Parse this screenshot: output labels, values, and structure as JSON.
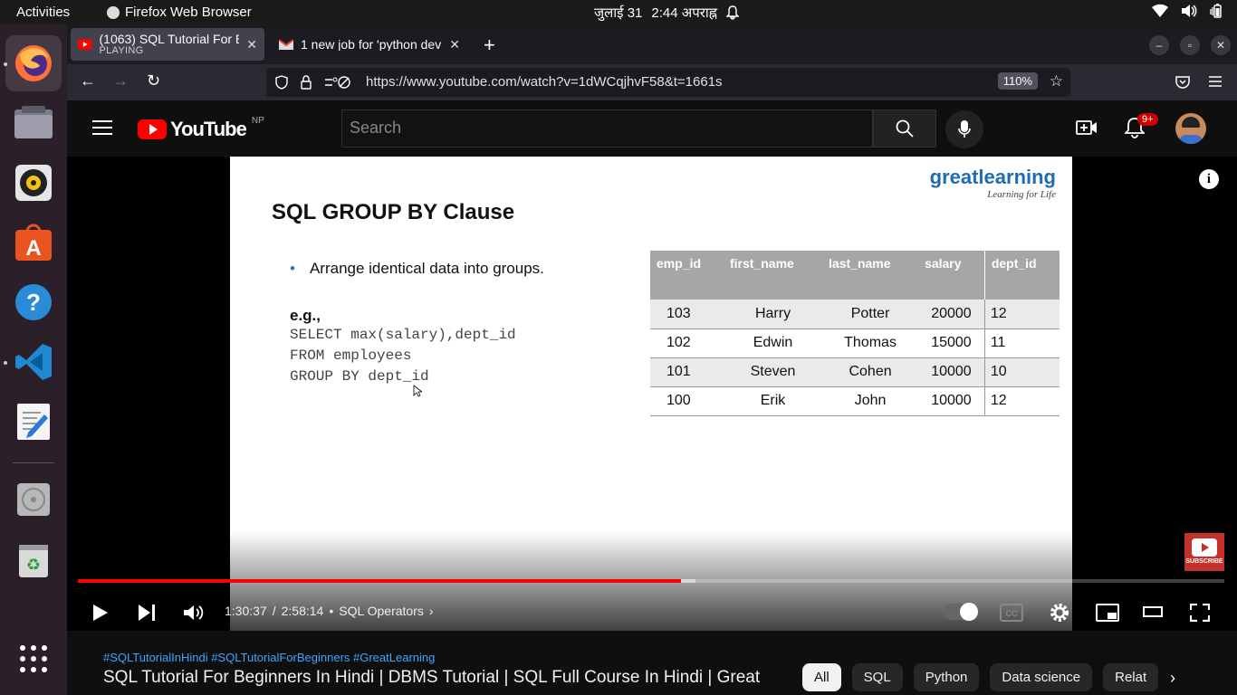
{
  "topbar": {
    "activities": "Activities",
    "app_name": "Firefox Web Browser",
    "date": "जुलाई 31",
    "time": "2:44 अपराह्न"
  },
  "dock": {
    "items": [
      "firefox",
      "files",
      "rhythmbox",
      "software",
      "help",
      "vscode",
      "text-editor",
      "disc",
      "trash",
      "show-apps"
    ]
  },
  "browser": {
    "tabs": [
      {
        "title": "(1063) SQL Tutorial For B",
        "subtitle": "PLAYING",
        "active": true
      },
      {
        "title": "1 new job for 'python dev",
        "subtitle": "",
        "active": false
      }
    ],
    "new_tab": "+",
    "url": "https://www.youtube.com/watch?v=1dWCqjhvF58&t=1661s",
    "zoom": "110%"
  },
  "youtube": {
    "logo_text": "YouTube",
    "region": "NP",
    "search_placeholder": "Search",
    "notifications_badge": "9+"
  },
  "slide": {
    "brand_name": "greatlearning",
    "brand_tagline": "Learning for Life",
    "title": "SQL GROUP BY Clause",
    "bullet": "Arrange identical data into groups.",
    "eg_label": "e.g.,",
    "code_lines": [
      "SELECT max(salary),dept_id",
      "FROM employees",
      "GROUP BY dept_id"
    ],
    "table": {
      "headers": [
        "emp_id",
        "first_name",
        "last_name",
        "salary",
        "dept_id"
      ],
      "rows": [
        [
          "103",
          "Harry",
          "Potter",
          "20000",
          "12"
        ],
        [
          "102",
          "Edwin",
          "Thomas",
          "15000",
          "11"
        ],
        [
          "101",
          "Steven",
          "Cohen",
          "10000",
          "10"
        ],
        [
          "100",
          "Erik",
          "John",
          "10000",
          "12"
        ]
      ]
    }
  },
  "player": {
    "time_current": "1:30:37",
    "time_total": "2:58:14",
    "chapter": "SQL Operators",
    "subscribe_label": "SUBSCRIBE",
    "played_fraction": 0.526,
    "loaded_fraction": 0.539
  },
  "video": {
    "hashtags": "#SQLTutorialInHindi #SQLTutorialForBeginners #GreatLearning",
    "title": "SQL Tutorial For Beginners In Hindi | DBMS Tutorial | SQL Full Course In Hindi | Great",
    "chips": [
      "All",
      "SQL",
      "Python",
      "Data science",
      "Relat"
    ]
  }
}
